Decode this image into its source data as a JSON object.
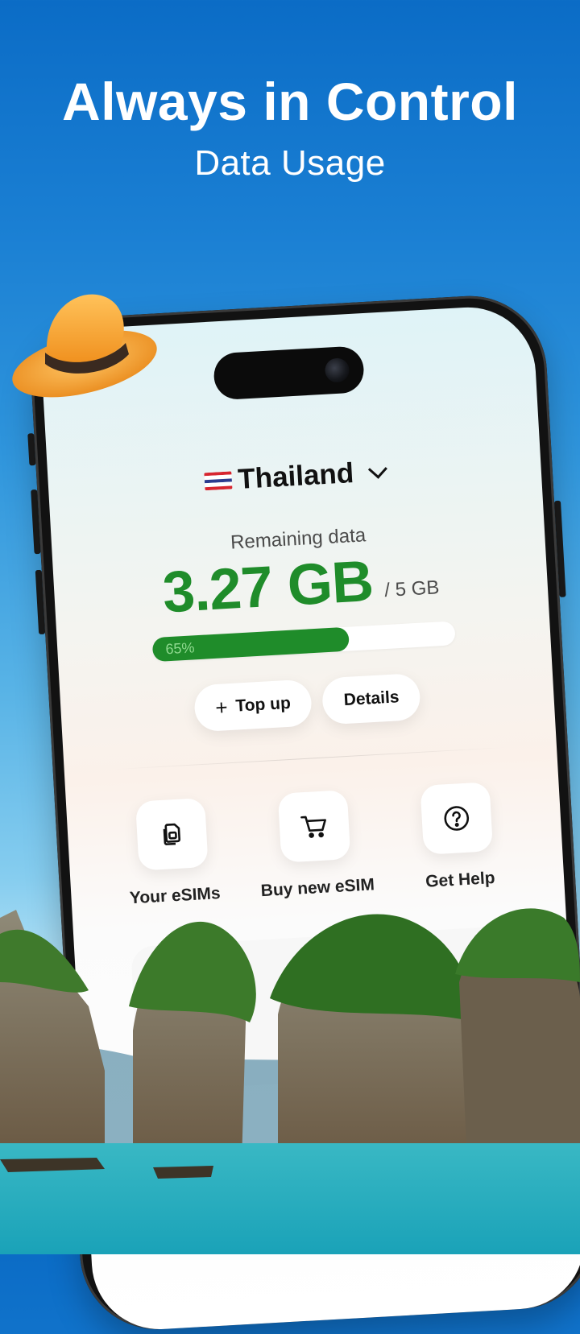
{
  "header": {
    "headline": "Always in Control",
    "subhead": "Data Usage"
  },
  "app": {
    "country": {
      "flag_icon": "thailand-flag-icon",
      "name": "Thailand",
      "dropdown_icon": "chevron-down-icon"
    },
    "usage": {
      "label": "Remaining data",
      "remaining": "3.27 GB",
      "total": "/ 5 GB",
      "percent_label": "65%",
      "percent_value": 0.65
    },
    "buttons": {
      "top_up": "Top up",
      "top_up_icon": "plus-icon",
      "details": "Details"
    },
    "actions": [
      {
        "label": "Your eSIMs",
        "icon": "sim-cards-icon"
      },
      {
        "label": "Buy new eSIM",
        "icon": "cart-icon"
      },
      {
        "label": "Get Help",
        "icon": "help-circle-icon"
      }
    ]
  },
  "colors": {
    "accent_green": "#1f8c2a",
    "sky_blue": "#0b6cc6"
  }
}
